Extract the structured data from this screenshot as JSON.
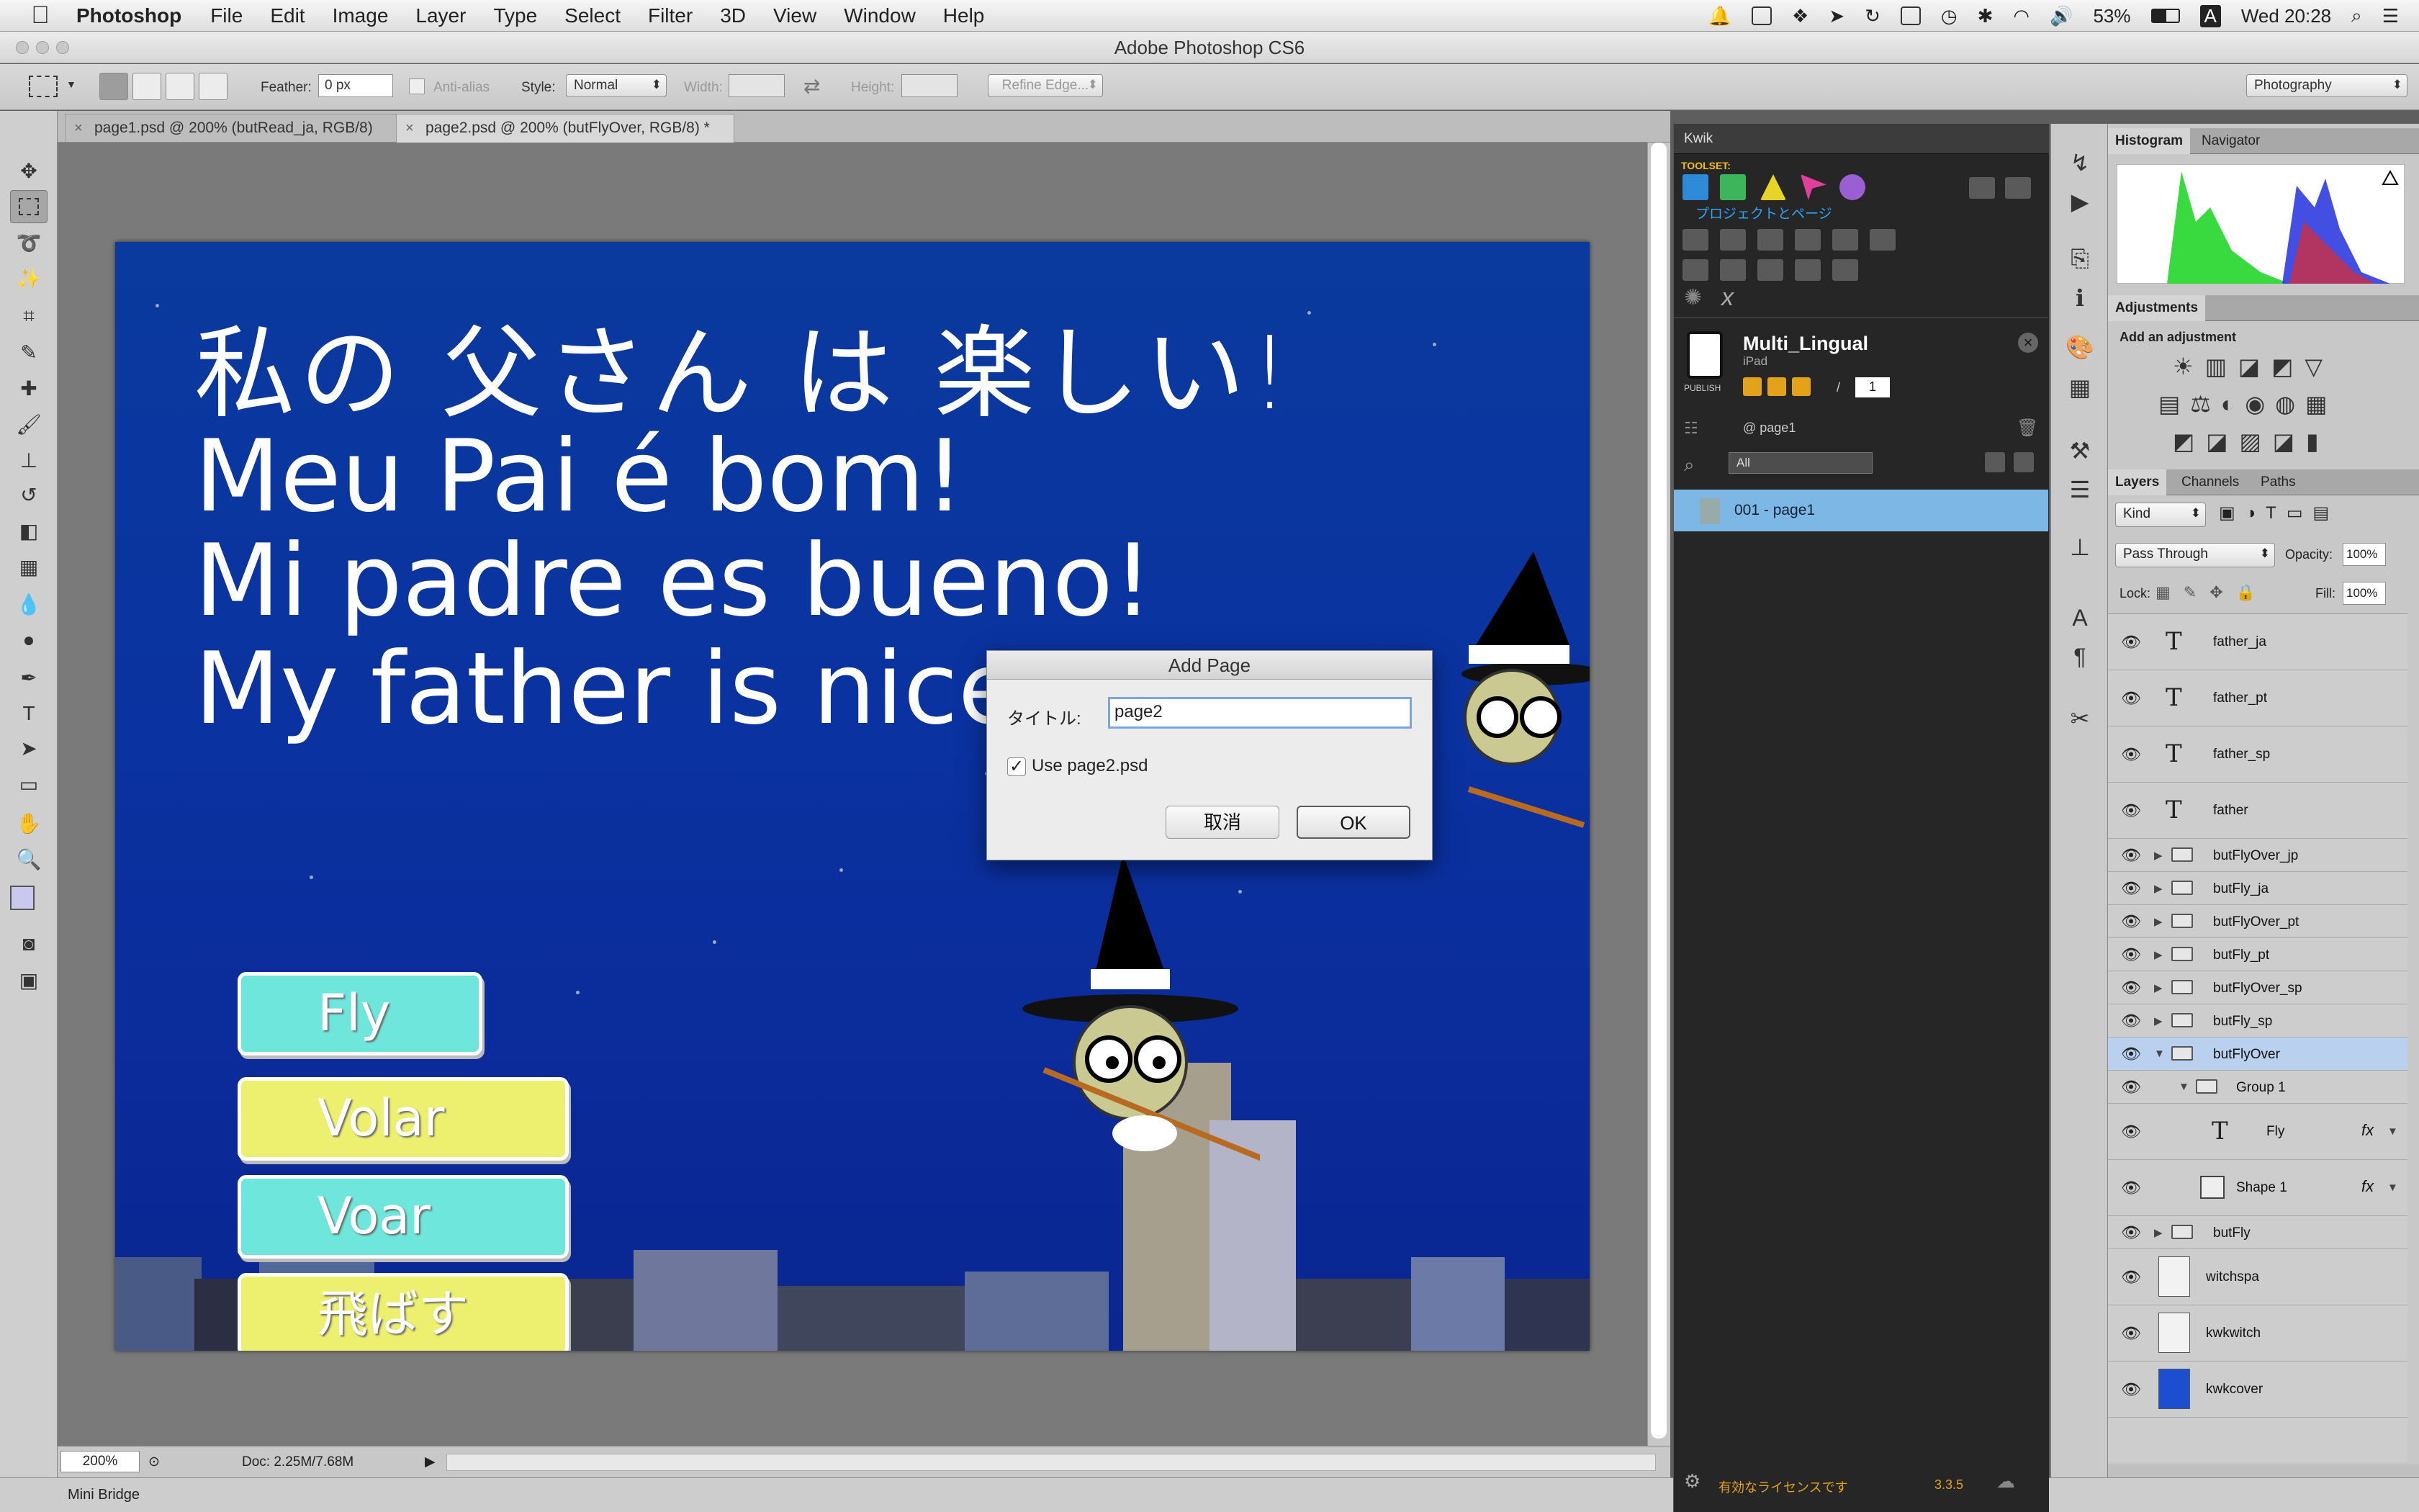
{
  "menubar": {
    "app_name": "Photoshop",
    "items": [
      "File",
      "Edit",
      "Image",
      "Layer",
      "Type",
      "Select",
      "Filter",
      "3D",
      "View",
      "Window",
      "Help"
    ],
    "battery": "53%",
    "input_source": "A",
    "clock": "Wed 20:28"
  },
  "window": {
    "title": "Adobe Photoshop CS6"
  },
  "options_bar": {
    "feather_label": "Feather:",
    "feather_value": "0 px",
    "antialias_label": "Anti-alias",
    "style_label": "Style:",
    "style_value": "Normal",
    "width_label": "Width:",
    "height_label": "Height:",
    "refine_edge": "Refine Edge...",
    "workspace": "Photography"
  },
  "doc_tabs": [
    {
      "label": "page1.psd @ 200% (butRead_ja, RGB/8)"
    },
    {
      "label": "page2.psd @ 200% (butFlyOver, RGB/8) *"
    }
  ],
  "artboard": {
    "phrases": [
      "私の 父さん は 楽しい!",
      "Meu Pai é bom!",
      "Mi padre es bueno!",
      "My father is nice!"
    ],
    "buttons": [
      {
        "label": "Fly",
        "color": "#6ee6dc"
      },
      {
        "label": "Volar",
        "color": "#ecf06e"
      },
      {
        "label": "Voar",
        "color": "#6ee6dc"
      },
      {
        "label": "飛ばす",
        "color": "#ecf06e"
      }
    ],
    "bg_color": "#0b34a0"
  },
  "dialog": {
    "title": "Add Page",
    "title_label": "タイトル:",
    "title_value": "page2",
    "checkbox_label": "Use page2.psd",
    "cancel": "取消",
    "ok": "OK"
  },
  "status": {
    "zoom": "200%",
    "doc_size": "Doc: 2.25M/7.68M"
  },
  "mini_bridge": "Mini Bridge",
  "kwik": {
    "tab": "Kwik",
    "toolset_label": "TOOLSET:",
    "section": "プロジェクトとページ",
    "project_name": "Multi_Lingual",
    "device": "iPad",
    "publish": "PUBLISH",
    "slash": "/",
    "page_count": "1",
    "current_page": "@ page1",
    "filter": "All",
    "page_item": "001 - page1",
    "license": "有効なライセンスです",
    "version": "3.3.5"
  },
  "histogram": {
    "tabs": [
      "Histogram",
      "Navigator"
    ]
  },
  "adjustments": {
    "tab": "Adjustments",
    "hint": "Add an adjustment"
  },
  "layers_panel": {
    "tabs": [
      "Layers",
      "Channels",
      "Paths"
    ],
    "kind": "Kind",
    "blend_mode": "Pass Through",
    "opacity_label": "Opacity:",
    "opacity": "100%",
    "lock_label": "Lock:",
    "fill_label": "Fill:",
    "fill": "100%",
    "fx": "fx",
    "layers": [
      {
        "name": "father_ja",
        "type": "text"
      },
      {
        "name": "father_pt",
        "type": "text"
      },
      {
        "name": "father_sp",
        "type": "text"
      },
      {
        "name": "father",
        "type": "text"
      },
      {
        "name": "butFlyOver_jp",
        "type": "group"
      },
      {
        "name": "butFly_ja",
        "type": "group"
      },
      {
        "name": "butFlyOver_pt",
        "type": "group"
      },
      {
        "name": "butFly_pt",
        "type": "group"
      },
      {
        "name": "butFlyOver_sp",
        "type": "group"
      },
      {
        "name": "butFly_sp",
        "type": "group"
      },
      {
        "name": "butFlyOver",
        "type": "group-open"
      },
      {
        "name": "Group 1",
        "type": "group-open"
      },
      {
        "name": "Fly",
        "type": "text-fx"
      },
      {
        "name": "Shape 1",
        "type": "shape-fx"
      },
      {
        "name": "butFly",
        "type": "group"
      },
      {
        "name": "witchspa",
        "type": "image"
      },
      {
        "name": "kwkwitch",
        "type": "image"
      },
      {
        "name": "kwkcover",
        "type": "image"
      }
    ]
  }
}
